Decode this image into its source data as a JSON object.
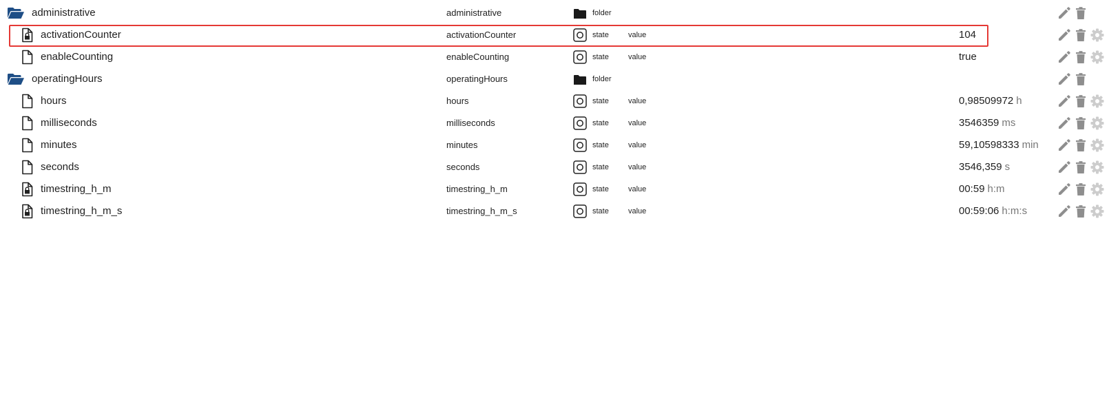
{
  "colors": {
    "folder_icon": "#1e4e86",
    "selection_border": "#e53935",
    "action_icon": "#8e8e8e",
    "settings_icon": "#cdcdcd"
  },
  "rows": [
    {
      "name": "administrative",
      "node_type": "folder",
      "icon": "folder-open-icon",
      "column_name": "administrative",
      "kind": "folder",
      "kind_icon": "folder-icon",
      "role": "",
      "value": "",
      "unit": "",
      "selected": false,
      "has_settings": false
    },
    {
      "name": "activationCounter",
      "node_type": "file",
      "icon": "locked-file-icon",
      "column_name": "activationCounter",
      "kind": "state",
      "kind_icon": "state-icon",
      "role": "value",
      "value": "104",
      "unit": "",
      "selected": true,
      "has_settings": true
    },
    {
      "name": "enableCounting",
      "node_type": "file",
      "icon": "file-icon",
      "column_name": "enableCounting",
      "kind": "state",
      "kind_icon": "state-icon",
      "role": "value",
      "value": "true",
      "unit": "",
      "selected": false,
      "has_settings": true
    },
    {
      "name": "operatingHours",
      "node_type": "folder",
      "icon": "folder-open-icon",
      "column_name": "operatingHours",
      "kind": "folder",
      "kind_icon": "folder-icon",
      "role": "",
      "value": "",
      "unit": "",
      "selected": false,
      "has_settings": false
    },
    {
      "name": "hours",
      "node_type": "file",
      "icon": "file-icon",
      "column_name": "hours",
      "kind": "state",
      "kind_icon": "state-icon",
      "role": "value",
      "value": "0,98509972",
      "unit": "h",
      "selected": false,
      "has_settings": true
    },
    {
      "name": "milliseconds",
      "node_type": "file",
      "icon": "file-icon",
      "column_name": "milliseconds",
      "kind": "state",
      "kind_icon": "state-icon",
      "role": "value",
      "value": "3546359",
      "unit": "ms",
      "selected": false,
      "has_settings": true
    },
    {
      "name": "minutes",
      "node_type": "file",
      "icon": "file-icon",
      "column_name": "minutes",
      "kind": "state",
      "kind_icon": "state-icon",
      "role": "value",
      "value": "59,10598333",
      "unit": "min",
      "selected": false,
      "has_settings": true
    },
    {
      "name": "seconds",
      "node_type": "file",
      "icon": "file-icon",
      "column_name": "seconds",
      "kind": "state",
      "kind_icon": "state-icon",
      "role": "value",
      "value": "3546,359",
      "unit": "s",
      "selected": false,
      "has_settings": true
    },
    {
      "name": "timestring_h_m",
      "node_type": "file",
      "icon": "locked-file-icon",
      "column_name": "timestring_h_m",
      "kind": "state",
      "kind_icon": "state-icon",
      "role": "value",
      "value": "00:59",
      "unit": "h:m",
      "selected": false,
      "has_settings": true
    },
    {
      "name": "timestring_h_m_s",
      "node_type": "file",
      "icon": "locked-file-icon",
      "column_name": "timestring_h_m_s",
      "kind": "state",
      "kind_icon": "state-icon",
      "role": "value",
      "value": "00:59:06",
      "unit": "h:m:s",
      "selected": false,
      "has_settings": true
    }
  ]
}
